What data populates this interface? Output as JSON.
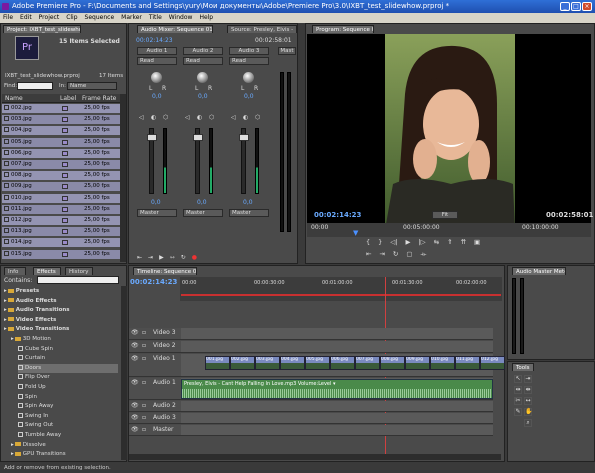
{
  "window": {
    "title": "Adobe Premiere Pro - F:\\Documents and Settings\\yury\\Мои документы\\Adobe\\Premiere Pro\\3.0\\IXBT_test_slidewhow.prproj *"
  },
  "menu": [
    "File",
    "Edit",
    "Project",
    "Clip",
    "Sequence",
    "Marker",
    "Title",
    "Window",
    "Help"
  ],
  "project": {
    "tab": "Project: IXBT_test_slidewhow",
    "selected": "15 Items Selected",
    "filename": "IXBT_test_slidewhow.prproj",
    "count": "17 Items",
    "find_label": "Find:",
    "in_label": "In:",
    "in_value": "Name",
    "col_name": "Name",
    "col_label": "Label",
    "col_rate": "Frame Rate",
    "items": [
      {
        "name": "002.jpg",
        "rate": "25,00 fps"
      },
      {
        "name": "003.jpg",
        "rate": "25,00 fps"
      },
      {
        "name": "004.jpg",
        "rate": "25,00 fps"
      },
      {
        "name": "005.jpg",
        "rate": "25,00 fps"
      },
      {
        "name": "006.jpg",
        "rate": "25,00 fps"
      },
      {
        "name": "007.jpg",
        "rate": "25,00 fps"
      },
      {
        "name": "008.jpg",
        "rate": "25,00 fps"
      },
      {
        "name": "009.jpg",
        "rate": "25,00 fps"
      },
      {
        "name": "010.jpg",
        "rate": "25,00 fps"
      },
      {
        "name": "011.jpg",
        "rate": "25,00 fps"
      },
      {
        "name": "012.jpg",
        "rate": "25,00 fps"
      },
      {
        "name": "013.jpg",
        "rate": "25,00 fps"
      },
      {
        "name": "014.jpg",
        "rate": "25,00 fps"
      },
      {
        "name": "015.jpg",
        "rate": "25,00 fps"
      }
    ],
    "thumb_label": "Pr"
  },
  "mixer": {
    "tab": "Audio Mixer: Sequence 01",
    "tab2": "Source: Presley, Elvis -",
    "time_left": "00:02:14:23",
    "time_right": "00:02:58:01",
    "channels": [
      {
        "name": "Audio 1",
        "mode": "Read",
        "val": "0,0",
        "out": "Master"
      },
      {
        "name": "Audio 2",
        "mode": "Read",
        "val": "0,0",
        "out": "Master"
      },
      {
        "name": "Audio 3",
        "mode": "Read",
        "val": "0,0",
        "out": "Master"
      }
    ],
    "master": "Mast",
    "lr": [
      "L",
      "R"
    ]
  },
  "program": {
    "tab": "Program: Sequence 01",
    "time_left": "00:02:14:23",
    "fit": "Fit",
    "time_right": "00:02:58:01",
    "ruler": [
      "00:00",
      "00:05:00:00",
      "00:10:00:00"
    ]
  },
  "effects": {
    "tabs": [
      "Info",
      "Effects",
      "History"
    ],
    "contains": "Contains:",
    "tree": [
      {
        "label": "Presets",
        "kind": "folder",
        "indent": 0
      },
      {
        "label": "Audio Effects",
        "kind": "folder",
        "indent": 0
      },
      {
        "label": "Audio Transitions",
        "kind": "folder",
        "indent": 0
      },
      {
        "label": "Video Effects",
        "kind": "folder",
        "indent": 0
      },
      {
        "label": "Video Transitions",
        "kind": "folder",
        "indent": 0
      },
      {
        "label": "3D Motion",
        "kind": "folder",
        "indent": 1
      },
      {
        "label": "Cube Spin",
        "kind": "item",
        "indent": 2
      },
      {
        "label": "Curtain",
        "kind": "item",
        "indent": 2
      },
      {
        "label": "Doors",
        "kind": "item",
        "indent": 2
      },
      {
        "label": "Flip Over",
        "kind": "item",
        "indent": 2
      },
      {
        "label": "Fold Up",
        "kind": "item",
        "indent": 2
      },
      {
        "label": "Spin",
        "kind": "item",
        "indent": 2
      },
      {
        "label": "Spin Away",
        "kind": "item",
        "indent": 2
      },
      {
        "label": "Swing In",
        "kind": "item",
        "indent": 2
      },
      {
        "label": "Swing Out",
        "kind": "item",
        "indent": 2
      },
      {
        "label": "Tumble Away",
        "kind": "item",
        "indent": 2
      },
      {
        "label": "Dissolve",
        "kind": "folder",
        "indent": 1
      },
      {
        "label": "GPU Transitions",
        "kind": "folder",
        "indent": 1
      }
    ]
  },
  "timeline": {
    "tab": "Timeline: Sequence 01",
    "time": "00:02:14:23",
    "ruler": [
      "00:00",
      "00:00:30:00",
      "00:01:00:00",
      "00:01:30:00",
      "00:02:00:00"
    ],
    "tracks": [
      "Video 3",
      "Video 2",
      "Video 1",
      "Audio 1",
      "Audio 2",
      "Audio 3",
      "Master"
    ],
    "clips": [
      "001.jpg",
      "002.jpg",
      "003.jpg",
      "004.jpg",
      "005.jpg",
      "006.jpg",
      "007.jpg",
      "008.jpg",
      "009.jpg",
      "010.jpg",
      "011.jpg",
      "012.jpg"
    ],
    "audio_clip": "Presley, Elvis - Cant Help Falling In Love.mp3  Volume:Level ▾"
  },
  "audio_master": {
    "tab": "Audio Master Meters"
  },
  "tools": {
    "tab": "Tools"
  },
  "status": "Add or remove from existing selection."
}
